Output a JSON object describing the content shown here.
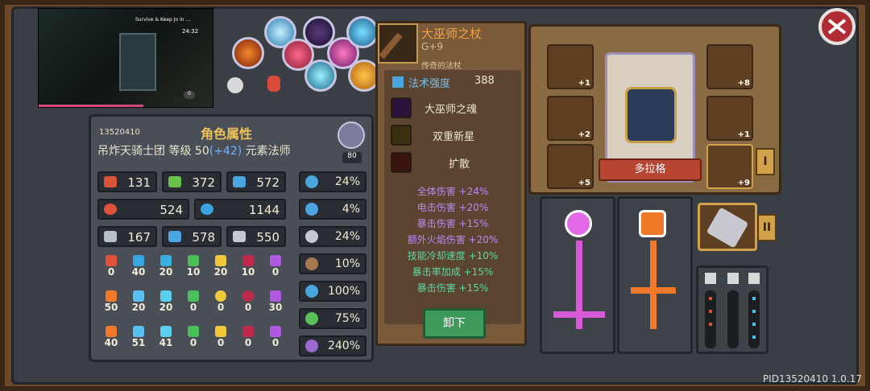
{
  "video": {
    "title": "Survive & Keep Jo in ...",
    "time": "24:32",
    "badge": "0"
  },
  "attributes": {
    "player_id": "13520410",
    "title": "角色属性",
    "guild": "吊炸天骑士团",
    "level_label": "等级",
    "level": "50",
    "level_bonus": "(+42)",
    "class": "元素法师",
    "rank": "80",
    "stats": [
      "131",
      "372",
      "572",
      "524",
      "1144",
      "167",
      "578",
      "550"
    ],
    "percents": [
      "24%",
      "4%",
      "24%",
      "10%",
      "100%",
      "75%",
      "240%"
    ],
    "elements": [
      [
        "0",
        "40",
        "20",
        "10",
        "20",
        "10",
        "0"
      ],
      [
        "50",
        "20",
        "20",
        "0",
        "0",
        "0",
        "30"
      ],
      [
        "40",
        "51",
        "41",
        "0",
        "0",
        "0",
        "0"
      ]
    ]
  },
  "tooltip": {
    "name": "大巫师之杖",
    "grade": "G+9",
    "subtitle": "传奇的法杖",
    "power_label": "法术强度",
    "power_value": "388",
    "skills": [
      "大巫师之魂",
      "双重新星",
      "扩散"
    ],
    "bonuses": [
      {
        "text": "全体伤害 +24%",
        "color": "#b48cf0"
      },
      {
        "text": "电击伤害 +20%",
        "color": "#b48cf0"
      },
      {
        "text": "暴击伤害 +15%",
        "color": "#b48cf0"
      },
      {
        "text": "额外火焰伤害 +20%",
        "color": "#b48cf0"
      },
      {
        "text": "技能冷却速度 +10%",
        "color": "#5fd7a3"
      },
      {
        "text": "暴击率加成 +15%",
        "color": "#5fd7a3"
      },
      {
        "text": "暴击伤害 +15%",
        "color": "#5fd7a3"
      }
    ],
    "unequip_label": "卸下"
  },
  "equipment": {
    "character_name": "多拉格",
    "left_slots": [
      "+1",
      "+2",
      "+5"
    ],
    "right_slots": [
      "+8",
      "+1",
      "+9"
    ],
    "tab1": "I",
    "tab2": "II"
  },
  "footer": {
    "pid": "PID13520410 1.0.17"
  }
}
